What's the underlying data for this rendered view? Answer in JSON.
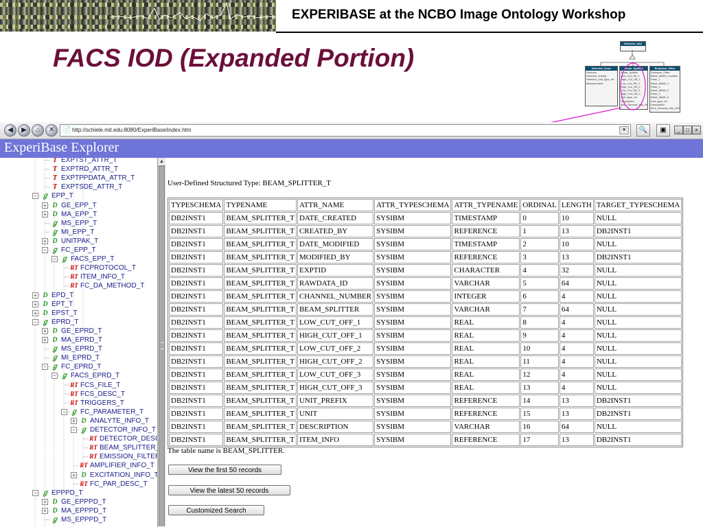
{
  "slide": {
    "header_title": "EXPERIBASE at the NCBO Image Ontology Workshop",
    "title": "FACS IOD (Expanded Portion)"
  },
  "uml": {
    "top": {
      "name": "Detector_Info"
    },
    "left": {
      "name": "Detector_Desc",
      "items": [
        "Detector",
        "Detector_setting",
        "Detector_unit_type_ref",
        "Measurement"
      ]
    },
    "middle": {
      "name": "Beam_Splitter",
      "items": [
        "Beam_Splitter",
        "Low_Cut_Off_1",
        "High_Cut_Off_1",
        "Low_Cut_Off_2",
        "High_Cut_Off_2",
        "Low_Cut_Off_3",
        "High_Cut_Off_3",
        "Unit_type_ref",
        "Description",
        "Item_General_Info_Ref"
      ]
    },
    "right": {
      "name": "Emission_Filter",
      "items": [
        "Emission_Filter",
        "Band_Width_Location",
        "Peak_1",
        "Band_Width_1",
        "Peak_2",
        "Band_Width_2",
        "Peak_3",
        "Band_Width_3",
        "Unit_type_ref",
        "Description",
        "Item_General_Info_Ref"
      ]
    }
  },
  "browser": {
    "url": "http://schiele.mit.edu:8080/ExperiBase/index.htm",
    "nav_glyphs": [
      "◀",
      "▶",
      "⌂",
      "✕"
    ],
    "url_icon": "📄",
    "url_drop": "▾",
    "search_glyph": "🔍",
    "page_glyph": "▣",
    "win_glyphs": [
      "_",
      "□",
      "×"
    ]
  },
  "app": {
    "title": "ExperiBase Explorer"
  },
  "tree": {
    "nodes": [
      {
        "label": "EXPTST_ATTR_T",
        "icon": "t",
        "indent": 2
      },
      {
        "label": "EXPTRD_ATTR_T",
        "icon": "t",
        "indent": 2
      },
      {
        "label": "EXPTPPDATA_ATTR_T",
        "icon": "t",
        "indent": 2
      },
      {
        "label": "EXPTSDE_ATTR_T",
        "icon": "t",
        "indent": 2
      },
      {
        "label": "EPP_T",
        "icon": "s",
        "indent": 1,
        "expander": "−"
      },
      {
        "label": "GE_EPP_T",
        "icon": "d",
        "indent": 2,
        "expander": "+"
      },
      {
        "label": "MA_EPP_T",
        "icon": "d",
        "indent": 2,
        "expander": "+"
      },
      {
        "label": "MS_EPP_T",
        "icon": "s",
        "indent": 2
      },
      {
        "label": "MI_EPP_T",
        "icon": "s",
        "indent": 2
      },
      {
        "label": "UNITPAK_T",
        "icon": "d",
        "indent": 2,
        "expander": "+"
      },
      {
        "label": "FC_EPP_T",
        "icon": "s",
        "indent": 2,
        "expander": "−"
      },
      {
        "label": "FACS_EPP_T",
        "icon": "s",
        "indent": 3,
        "expander": "−"
      },
      {
        "label": "FCPROTOCOL_T",
        "icon": "rt",
        "indent": 4
      },
      {
        "label": "ITEM_INFO_T",
        "icon": "rt",
        "indent": 4
      },
      {
        "label": "FC_DA_METHOD_T",
        "icon": "rt",
        "indent": 4
      },
      {
        "label": "EPD_T",
        "icon": "d",
        "indent": 1,
        "expander": "+"
      },
      {
        "label": "EPT_T",
        "icon": "d",
        "indent": 1,
        "expander": "+"
      },
      {
        "label": "EPST_T",
        "icon": "d",
        "indent": 1,
        "expander": "+"
      },
      {
        "label": "EPRD_T",
        "icon": "s",
        "indent": 1,
        "expander": "−"
      },
      {
        "label": "GE_EPRD_T",
        "icon": "d",
        "indent": 2,
        "expander": "+"
      },
      {
        "label": "MA_EPRD_T",
        "icon": "d",
        "indent": 2,
        "expander": "+"
      },
      {
        "label": "MS_EPRD_T",
        "icon": "s",
        "indent": 2
      },
      {
        "label": "MI_EPRD_T",
        "icon": "s",
        "indent": 2
      },
      {
        "label": "FC_EPRD_T",
        "icon": "s",
        "indent": 2,
        "expander": "−"
      },
      {
        "label": "FACS_EPRD_T",
        "icon": "s",
        "indent": 3,
        "expander": "−"
      },
      {
        "label": "FCS_FILE_T",
        "icon": "rt",
        "indent": 4
      },
      {
        "label": "FCS_DESC_T",
        "icon": "rt",
        "indent": 4
      },
      {
        "label": "TRIGGERS_T",
        "icon": "rt",
        "indent": 4
      },
      {
        "label": "FC_PARAMETER_T",
        "icon": "s",
        "indent": 4,
        "expander": "−"
      },
      {
        "label": "ANALYTE_INFO_T",
        "icon": "d",
        "indent": 5,
        "expander": "+"
      },
      {
        "label": "DETECTOR_INFO_T",
        "icon": "s",
        "indent": 5,
        "expander": "−"
      },
      {
        "label": "DETECTOR_DESC_T",
        "icon": "rt",
        "indent": 6
      },
      {
        "label": "BEAM_SPLITTER_T",
        "icon": "rt",
        "indent": 6
      },
      {
        "label": "EMISSION_FILTER_T",
        "icon": "rt",
        "indent": 6
      },
      {
        "label": "AMPLIFIER_INFO_T",
        "icon": "rt",
        "indent": 5
      },
      {
        "label": "EXCITATION_INFO_T",
        "icon": "d",
        "indent": 5,
        "expander": "+"
      },
      {
        "label": "FC_PAR_DESC_T",
        "icon": "rt",
        "indent": 5
      },
      {
        "label": "EPPPD_T",
        "icon": "s",
        "indent": 1,
        "expander": "−"
      },
      {
        "label": "GE_EPPPD_T",
        "icon": "d",
        "indent": 2,
        "expander": "+"
      },
      {
        "label": "MA_EPPPD_T",
        "icon": "d",
        "indent": 2,
        "expander": "+"
      },
      {
        "label": "MS_EPPPD_T",
        "icon": "s",
        "indent": 2
      }
    ],
    "icon_glyphs": {
      "s": "ℊ",
      "d": "D",
      "t": "Ƭ",
      "rt": "RT"
    }
  },
  "content": {
    "type_label": "User-Defined Structured Type: BEAM_SPLITTER_T",
    "columns": [
      "TYPESCHEMA",
      "TYPENAME",
      "ATTR_NAME",
      "ATTR_TYPESCHEMA",
      "ATTR_TYPENAME",
      "ORDINAL",
      "LENGTH",
      "TARGET_TYPESCHEMA"
    ],
    "rows": [
      [
        "DB2INST1",
        "BEAM_SPLITTER_T",
        "DATE_CREATED",
        "SYSIBM",
        "TIMESTAMP",
        "0",
        "10",
        "NULL"
      ],
      [
        "DB2INST1",
        "BEAM_SPLITTER_T",
        "CREATED_BY",
        "SYSIBM",
        "REFERENCE",
        "1",
        "13",
        "DB2INST1"
      ],
      [
        "DB2INST1",
        "BEAM_SPLITTER_T",
        "DATE_MODIFIED",
        "SYSIBM",
        "TIMESTAMP",
        "2",
        "10",
        "NULL"
      ],
      [
        "DB2INST1",
        "BEAM_SPLITTER_T",
        "MODIFIED_BY",
        "SYSIBM",
        "REFERENCE",
        "3",
        "13",
        "DB2INST1"
      ],
      [
        "DB2INST1",
        "BEAM_SPLITTER_T",
        "EXPTID",
        "SYSIBM",
        "CHARACTER",
        "4",
        "32",
        "NULL"
      ],
      [
        "DB2INST1",
        "BEAM_SPLITTER_T",
        "RAWDATA_ID",
        "SYSIBM",
        "VARCHAR",
        "5",
        "64",
        "NULL"
      ],
      [
        "DB2INST1",
        "BEAM_SPLITTER_T",
        "CHANNEL_NUMBER",
        "SYSIBM",
        "INTEGER",
        "6",
        "4",
        "NULL"
      ],
      [
        "DB2INST1",
        "BEAM_SPLITTER_T",
        "BEAM_SPLITTER",
        "SYSIBM",
        "VARCHAR",
        "7",
        "64",
        "NULL"
      ],
      [
        "DB2INST1",
        "BEAM_SPLITTER_T",
        "LOW_CUT_OFF_1",
        "SYSIBM",
        "REAL",
        "8",
        "4",
        "NULL"
      ],
      [
        "DB2INST1",
        "BEAM_SPLITTER_T",
        "HIGH_CUT_OFF_1",
        "SYSIBM",
        "REAL",
        "9",
        "4",
        "NULL"
      ],
      [
        "DB2INST1",
        "BEAM_SPLITTER_T",
        "LOW_CUT_OFF_2",
        "SYSIBM",
        "REAL",
        "10",
        "4",
        "NULL"
      ],
      [
        "DB2INST1",
        "BEAM_SPLITTER_T",
        "HIGH_CUT_OFF_2",
        "SYSIBM",
        "REAL",
        "11",
        "4",
        "NULL"
      ],
      [
        "DB2INST1",
        "BEAM_SPLITTER_T",
        "LOW_CUT_OFF_3",
        "SYSIBM",
        "REAL",
        "12",
        "4",
        "NULL"
      ],
      [
        "DB2INST1",
        "BEAM_SPLITTER_T",
        "HIGH_CUT_OFF_3",
        "SYSIBM",
        "REAL",
        "13",
        "4",
        "NULL"
      ],
      [
        "DB2INST1",
        "BEAM_SPLITTER_T",
        "UNIT_PREFIX",
        "SYSIBM",
        "REFERENCE",
        "14",
        "13",
        "DB2INST1"
      ],
      [
        "DB2INST1",
        "BEAM_SPLITTER_T",
        "UNIT",
        "SYSIBM",
        "REFERENCE",
        "15",
        "13",
        "DB2INST1"
      ],
      [
        "DB2INST1",
        "BEAM_SPLITTER_T",
        "DESCRIPTION",
        "SYSIBM",
        "VARCHAR",
        "16",
        "64",
        "NULL"
      ],
      [
        "DB2INST1",
        "BEAM_SPLITTER_T",
        "ITEM_INFO",
        "SYSIBM",
        "REFERENCE",
        "17",
        "13",
        "DB2INST1"
      ]
    ],
    "table_name_text": "The table name is BEAM_SPLITTER.",
    "buttons": {
      "first": "View the first 50 records",
      "latest": "View the latest 50 records",
      "search": "Customized Search"
    }
  },
  "colors": {
    "banner": "#6f74d8",
    "title_maroon": "#6b0f3a",
    "annotation_magenta": "#e020d0",
    "tree_link": "#1a1a8a",
    "icon_green": "#2a9a2a",
    "icon_red": "#cc0000"
  }
}
